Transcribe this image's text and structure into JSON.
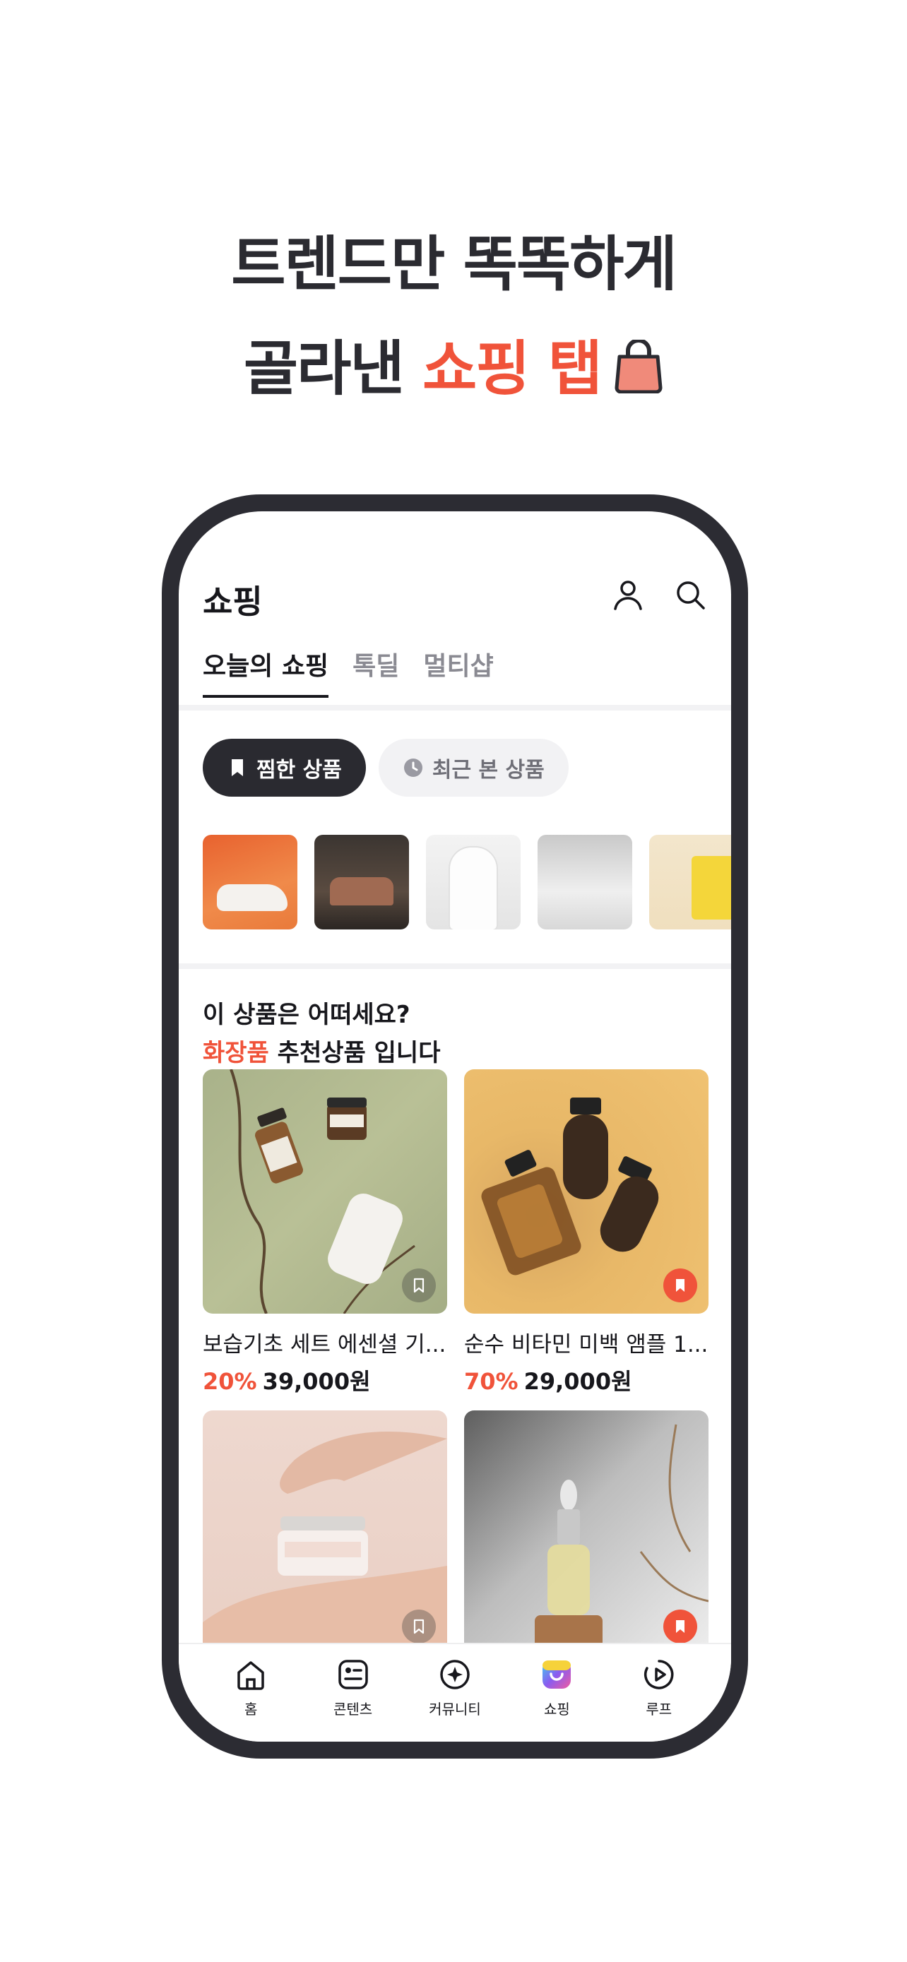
{
  "headline": {
    "line1": "트렌드만 똑똑하게",
    "line2_prefix": "골라낸 ",
    "line2_accent": "쇼핑 탭",
    "icon": "shopping-bag-icon"
  },
  "colors": {
    "accent": "#f0533a",
    "frame": "#2c2c33",
    "chip_dark": "#2a2a30"
  },
  "app": {
    "title": "쇼핑",
    "icons": [
      "user-icon",
      "search-icon"
    ],
    "tabs": [
      {
        "label": "오늘의 쇼핑",
        "active": true
      },
      {
        "label": "톡딜",
        "active": false
      },
      {
        "label": "멀티샵",
        "active": false
      }
    ],
    "chips": [
      {
        "label": "찜한 상품",
        "icon": "bookmark-icon",
        "active": true
      },
      {
        "label": "최근 본 상품",
        "icon": "clock-icon",
        "active": false
      }
    ],
    "thumbnails": [
      "sneaker",
      "sofa",
      "blouse",
      "bedding",
      "tissue-box"
    ],
    "recommend": {
      "line1": "이 상품은 어떠세요?",
      "line2_accent": "화장품",
      "line2_rest": " 추천상품 입니다"
    },
    "products": [
      {
        "name": "보습기초 세트 에센셜 기...",
        "discount": "20%",
        "price": "39,000원",
        "bookmarked": false
      },
      {
        "name": "순수 비타민 미백 앰플 1...",
        "discount": "70%",
        "price": "29,000원",
        "bookmarked": true
      },
      {
        "name": "",
        "discount": "",
        "price": "",
        "bookmarked": false
      },
      {
        "name": "",
        "discount": "",
        "price": "",
        "bookmarked": true
      }
    ],
    "bottom_nav": [
      {
        "label": "홈",
        "icon": "home-icon"
      },
      {
        "label": "콘텐츠",
        "icon": "content-icon"
      },
      {
        "label": "커뮤니티",
        "icon": "community-icon"
      },
      {
        "label": "쇼핑",
        "icon": "shopping-icon"
      },
      {
        "label": "루프",
        "icon": "loop-play-icon"
      }
    ]
  }
}
